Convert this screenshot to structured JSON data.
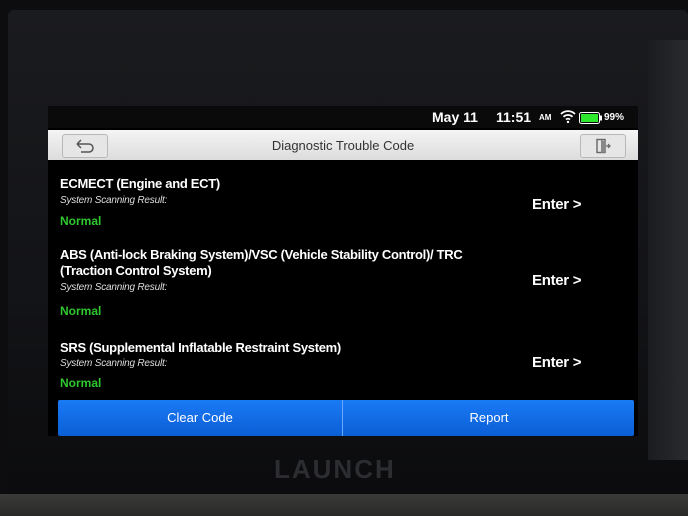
{
  "status": {
    "date": "May 11",
    "time": "11:51",
    "ampm": "AM",
    "battery": "99%"
  },
  "titlebar": {
    "title": "Diagnostic Trouble Code"
  },
  "items": [
    {
      "name": "ECMECT (Engine and ECT)",
      "label": "System Scanning Result:",
      "status": "Normal",
      "enter": "Enter >"
    },
    {
      "name": "ABS (Anti-lock Braking System)/VSC (Vehicle Stability Control)/ TRC (Traction Control System)",
      "label": "System Scanning Result:",
      "status": "Normal",
      "enter": "Enter >"
    },
    {
      "name": "SRS (Supplemental Inflatable Restraint System)",
      "label": "System Scanning Result:",
      "status": "Normal",
      "enter": "Enter >"
    }
  ],
  "buttons": {
    "clear_code": "Clear Code",
    "report": "Report"
  },
  "device": {
    "brand": "LAUNCH"
  },
  "colors": {
    "accent": "#0b6be8",
    "status_normal": "#2ec82e"
  }
}
